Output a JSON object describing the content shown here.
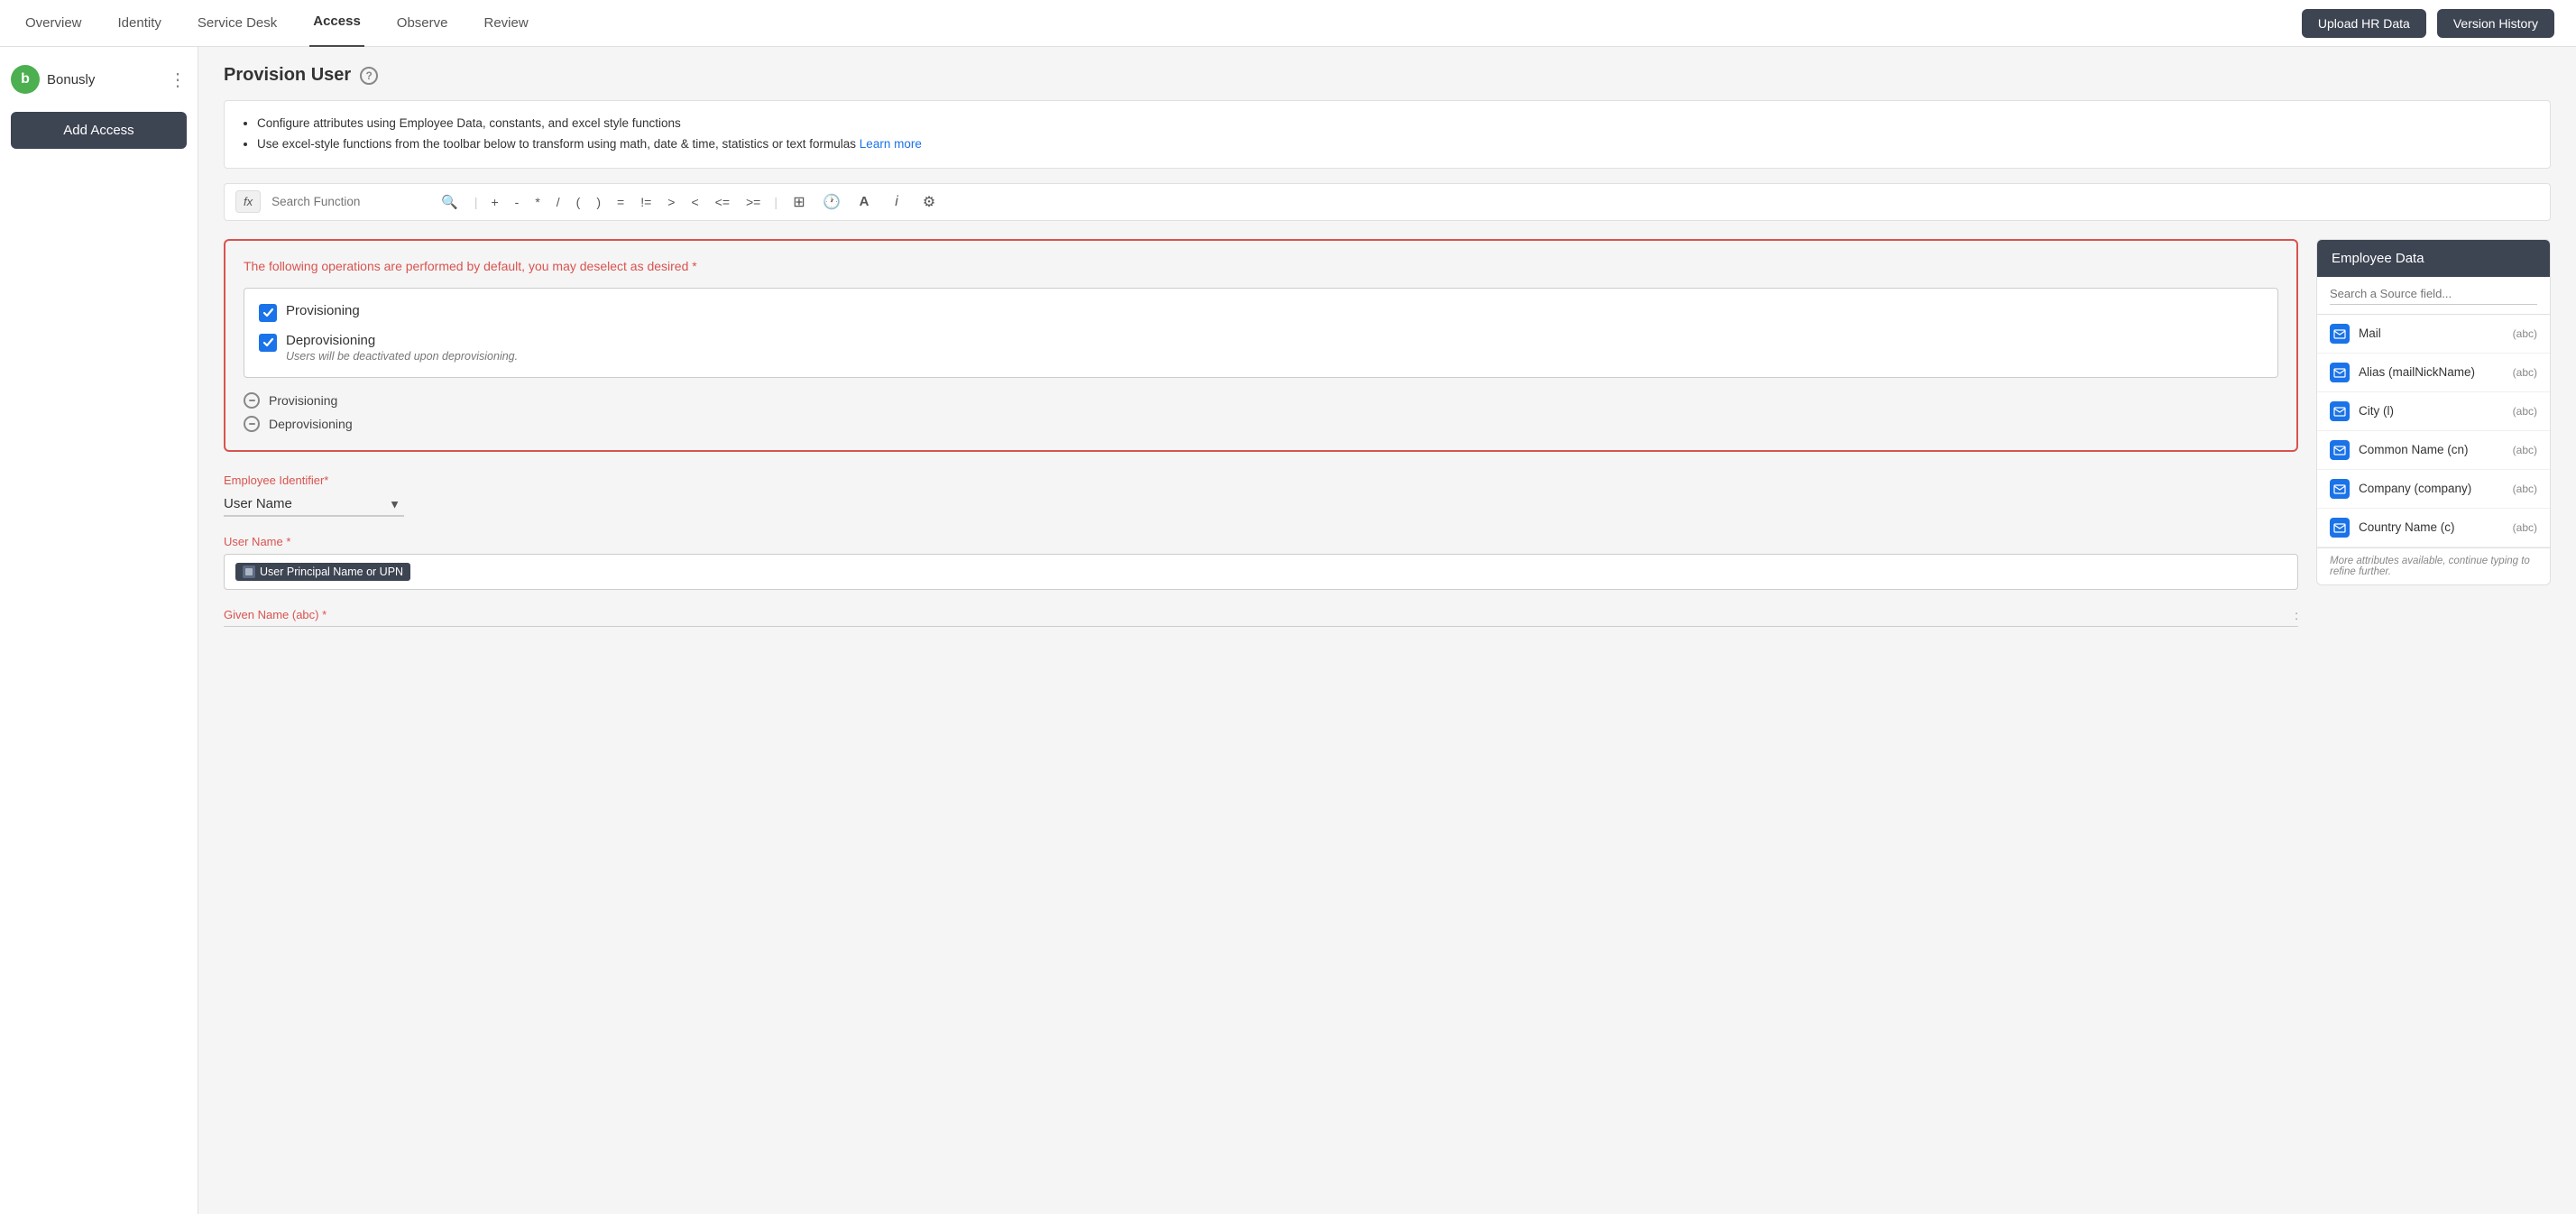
{
  "topNav": {
    "items": [
      {
        "label": "Overview",
        "active": false
      },
      {
        "label": "Identity",
        "active": false
      },
      {
        "label": "Service Desk",
        "active": false
      },
      {
        "label": "Access",
        "active": true
      },
      {
        "label": "Observe",
        "active": false
      },
      {
        "label": "Review",
        "active": false
      }
    ],
    "uploadHRData": "Upload HR Data",
    "versionHistory": "Version History"
  },
  "sidebar": {
    "brandLogo": "b",
    "brandName": "Bonusly",
    "addAccess": "Add Access"
  },
  "page": {
    "title": "Provision User",
    "helpIcon": "?",
    "info": {
      "line1": "Configure attributes using Employee Data, constants, and excel style functions",
      "line2": "Use excel-style functions from the toolbar below to transform using math, date & time, statistics or text formulas",
      "learnMore": "Learn more"
    },
    "toolbar": {
      "fxLabel": "fx",
      "searchPlaceholder": "Search Function",
      "operators": [
        "+",
        "-",
        "*",
        "/",
        "(",
        ")",
        "=",
        "!=",
        ">",
        "<",
        "<=",
        ">="
      ]
    },
    "operationsBox": {
      "label": "The following operations are performed by default, you may deselect as desired",
      "required": "*",
      "checkboxes": [
        {
          "label": "Provisioning",
          "checked": true
        },
        {
          "label": "Deprovisioning",
          "checked": true,
          "sub": "Users will be deactivated upon deprovisioning."
        }
      ],
      "circleOps": [
        {
          "label": "Provisioning"
        },
        {
          "label": "Deprovisioning"
        }
      ]
    },
    "employeeIdentifier": {
      "label": "Employee Identifier",
      "required": "*",
      "value": "User Name"
    },
    "userName": {
      "label": "User Name",
      "required": "*",
      "chipLabel": "User Principal Name or UPN"
    },
    "givenName": {
      "label": "Given Name (abc)",
      "required": "*",
      "colon": ":"
    }
  },
  "employeeData": {
    "panelTitle": "Employee Data",
    "searchPlaceholder": "Search a Source field...",
    "items": [
      {
        "name": "Mail",
        "type": "(abc)"
      },
      {
        "name": "Alias (mailNickName)",
        "type": "(abc)"
      },
      {
        "name": "City (l)",
        "type": "(abc)"
      },
      {
        "name": "Common Name (cn)",
        "type": "(abc)"
      },
      {
        "name": "Company (company)",
        "type": "(abc)"
      },
      {
        "name": "Country Name (c)",
        "type": "(abc)"
      }
    ],
    "footer": "More attributes available, continue typing to refine further."
  }
}
